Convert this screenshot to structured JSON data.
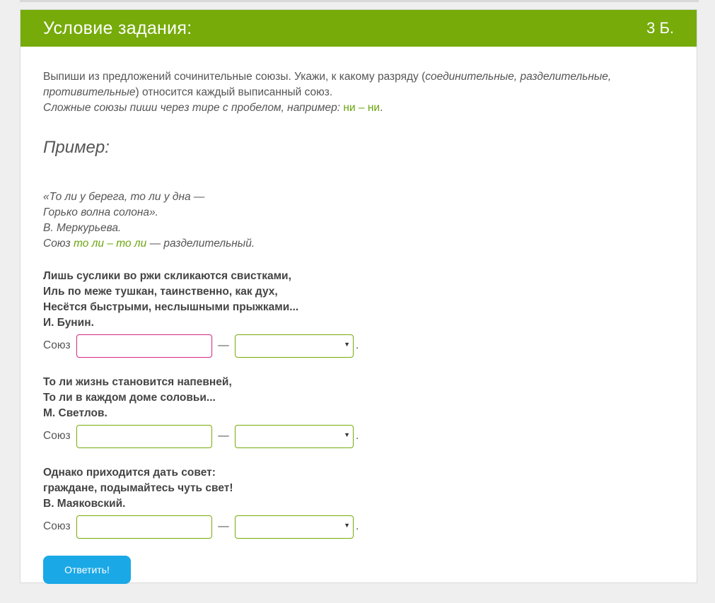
{
  "header": {
    "title": "Условие задания:",
    "points": "3 Б."
  },
  "instructions": {
    "p1_a": "Выпиши из предложений сочинительные союзы. Укажи, к какому разряду (",
    "p1_italic": "соединительные, разделительные, противительные",
    "p1_b": ") относится каждый выписанный союз.",
    "p2_italic": "Сложные союзы пиши через тире с пробелом, например: ",
    "p2_example": "ни – ни",
    "p2_end": "."
  },
  "example": {
    "heading": "Пример:",
    "line1": "«То ли у берега, то ли у дна —",
    "line2": "Горько волна солона».",
    "line3": "В. Меркурьева.",
    "union_prefix": "Союз ",
    "union_value": "то ли – то ли",
    "union_suffix": " — разделительный."
  },
  "tasks": [
    {
      "lines": [
        "Лишь суслики во ржи скликаются свистками,",
        "Иль по меже тушкан, таинственно, как дух,",
        "Несётся быстрыми, неслышными прыжками...",
        "И. Бунин."
      ],
      "label": "Союз",
      "value": "",
      "dash": "—",
      "period": "."
    },
    {
      "lines": [
        "То ли жизнь становится напевней,",
        "То ли в каждом доме соловьи...",
        "М. Светлов."
      ],
      "label": "Союз",
      "value": "",
      "dash": "—",
      "period": "."
    },
    {
      "lines": [
        "Однако приходится дать совет:",
        "граждане, подымайтесь чуть свет!",
        "В. Маяковский."
      ],
      "label": "Союз",
      "value": "",
      "dash": "—",
      "period": "."
    }
  ],
  "submit_label": "Ответить!",
  "colors": {
    "header_bg": "#76ab0a",
    "accent_green": "#6aa50e",
    "focus_border": "#d4318a",
    "button_bg": "#1ba8e6"
  }
}
